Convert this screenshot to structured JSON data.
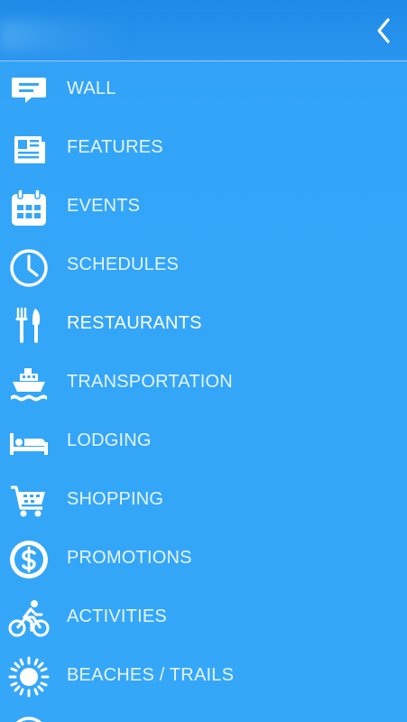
{
  "header": {
    "back_icon": "chevron-left-icon"
  },
  "menu": {
    "items": [
      {
        "label": "WALL",
        "icon": "chat-bubble-icon"
      },
      {
        "label": "FEATURES",
        "icon": "newspaper-icon"
      },
      {
        "label": "EVENTS",
        "icon": "calendar-icon"
      },
      {
        "label": "SCHEDULES",
        "icon": "clock-icon"
      },
      {
        "label": "RESTAURANTS",
        "icon": "fork-knife-icon"
      },
      {
        "label": "TRANSPORTATION",
        "icon": "ship-icon"
      },
      {
        "label": "LODGING",
        "icon": "bed-icon"
      },
      {
        "label": "SHOPPING",
        "icon": "shopping-cart-icon"
      },
      {
        "label": "PROMOTIONS",
        "icon": "dollar-circle-icon"
      },
      {
        "label": "ACTIVITIES",
        "icon": "cyclist-icon"
      },
      {
        "label": "BEACHES / TRAILS",
        "icon": "sun-icon"
      }
    ],
    "partial_item_icon": "circle-icon"
  },
  "colors": {
    "background": "#35a7f8",
    "header_background": "#2a95ef",
    "text": "#ffffff"
  }
}
